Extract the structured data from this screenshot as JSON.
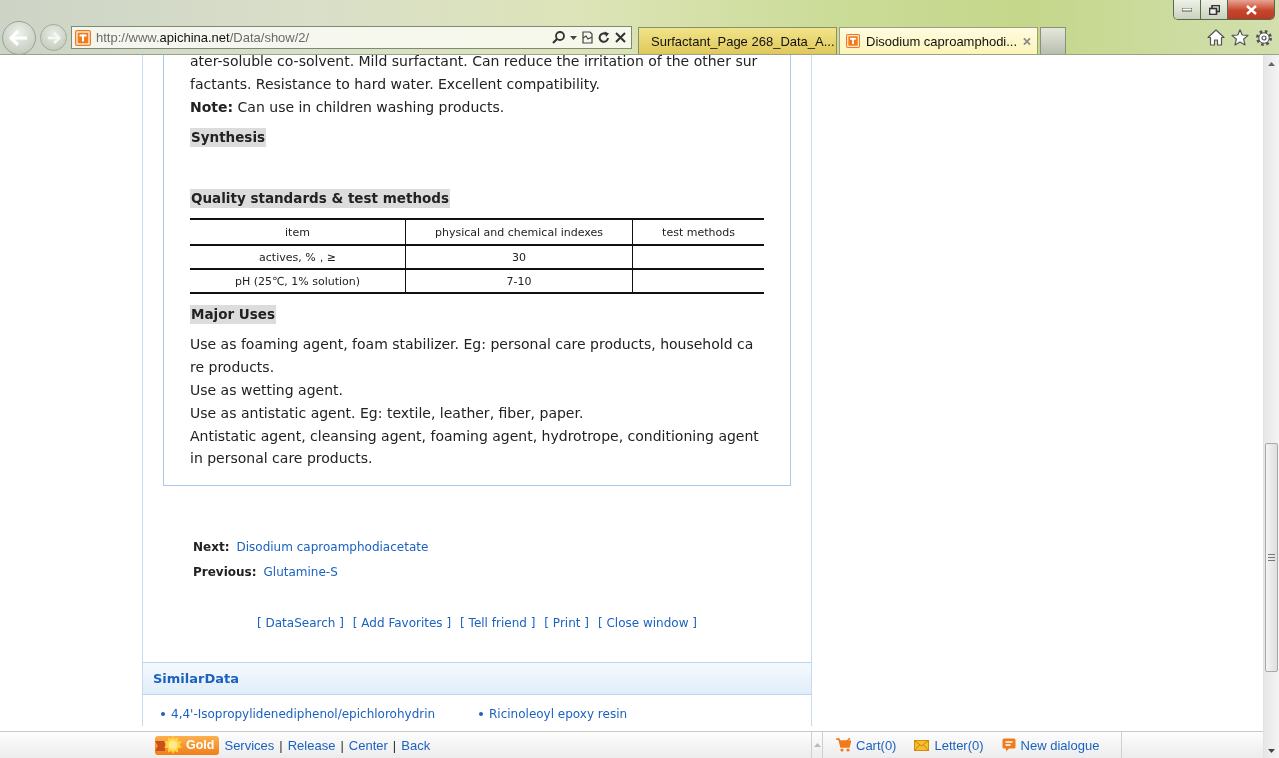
{
  "browser": {
    "address_bar": {
      "url_prefix": "http://www.",
      "url_domain": "apichina.net",
      "url_path": "/Data/show/2/"
    },
    "tabs": [
      {
        "title": "Surfactant_Page 268_Data_A...",
        "selected": false
      },
      {
        "title": "Disodium caproamphodi...",
        "selected": true
      }
    ]
  },
  "article": {
    "description": {
      "lines": [
        "ater-soluble co-solvent. Mild surfactant. Can reduce the irritation of the other sur",
        "factants. Resistance to hard water. Excellent compatibility."
      ]
    },
    "note": "**Note:** Can use in children washing products.",
    "synthesis": {
      "heading": "Synthesis"
    },
    "quality": {
      "heading": "Quality standards & test methods",
      "table": {
        "columns": [
          "item",
          "physical and chemical indexes",
          "test methods"
        ],
        "rows": [
          {
            "item": "actives, %，≥",
            "indexes": "30"
          },
          {
            "item": "pH (25℃, 1% solution)",
            "indexes": "7-10"
          }
        ]
      }
    },
    "major_uses": {
      "heading": "Major Uses",
      "paragraphs": [
        {
          "lines": [
            "Use as foaming agent, foam stabilizer. Eg: personal care products, household ca",
            "re products."
          ]
        },
        {
          "lines": [
            "Use as wetting agent."
          ]
        },
        {
          "lines": [
            "Use as antistatic agent. Eg: textile, leather, fiber, paper."
          ]
        },
        {
          "lines": [
            "Antistatic agent, cleansing agent, foaming agent, hydrotrope, conditioning agent",
            "in personal care products."
          ]
        }
      ]
    }
  },
  "navigation": {
    "next": {
      "label": "Next:",
      "title": "Disodium caproamphodiacetate"
    },
    "previous": {
      "label": "Previous:",
      "title": "Glutamine-S"
    }
  },
  "actions": [
    "[ DataSearch ]",
    "[ Add Favorites ]",
    "[ Tell friend ]",
    "[ Print ]",
    "[ Close window ]"
  ],
  "similar_data": {
    "title": "SimilarData",
    "items": [
      "4,4'-Isopropylidenediphenol/epichlorohydrin",
      "Ricinoleoyl epoxy resin"
    ]
  },
  "toolbar": {
    "badge": "Gold",
    "links": [
      {
        "label": "Services"
      },
      {
        "separator": "|",
        "label": "Release"
      },
      {
        "separator": "|",
        "label": "Center"
      },
      {
        "separator": "|",
        "label": "Back"
      }
    ],
    "cart": "Cart(0)",
    "letter": "Letter(0)",
    "dialogue": "New dialogue"
  }
}
